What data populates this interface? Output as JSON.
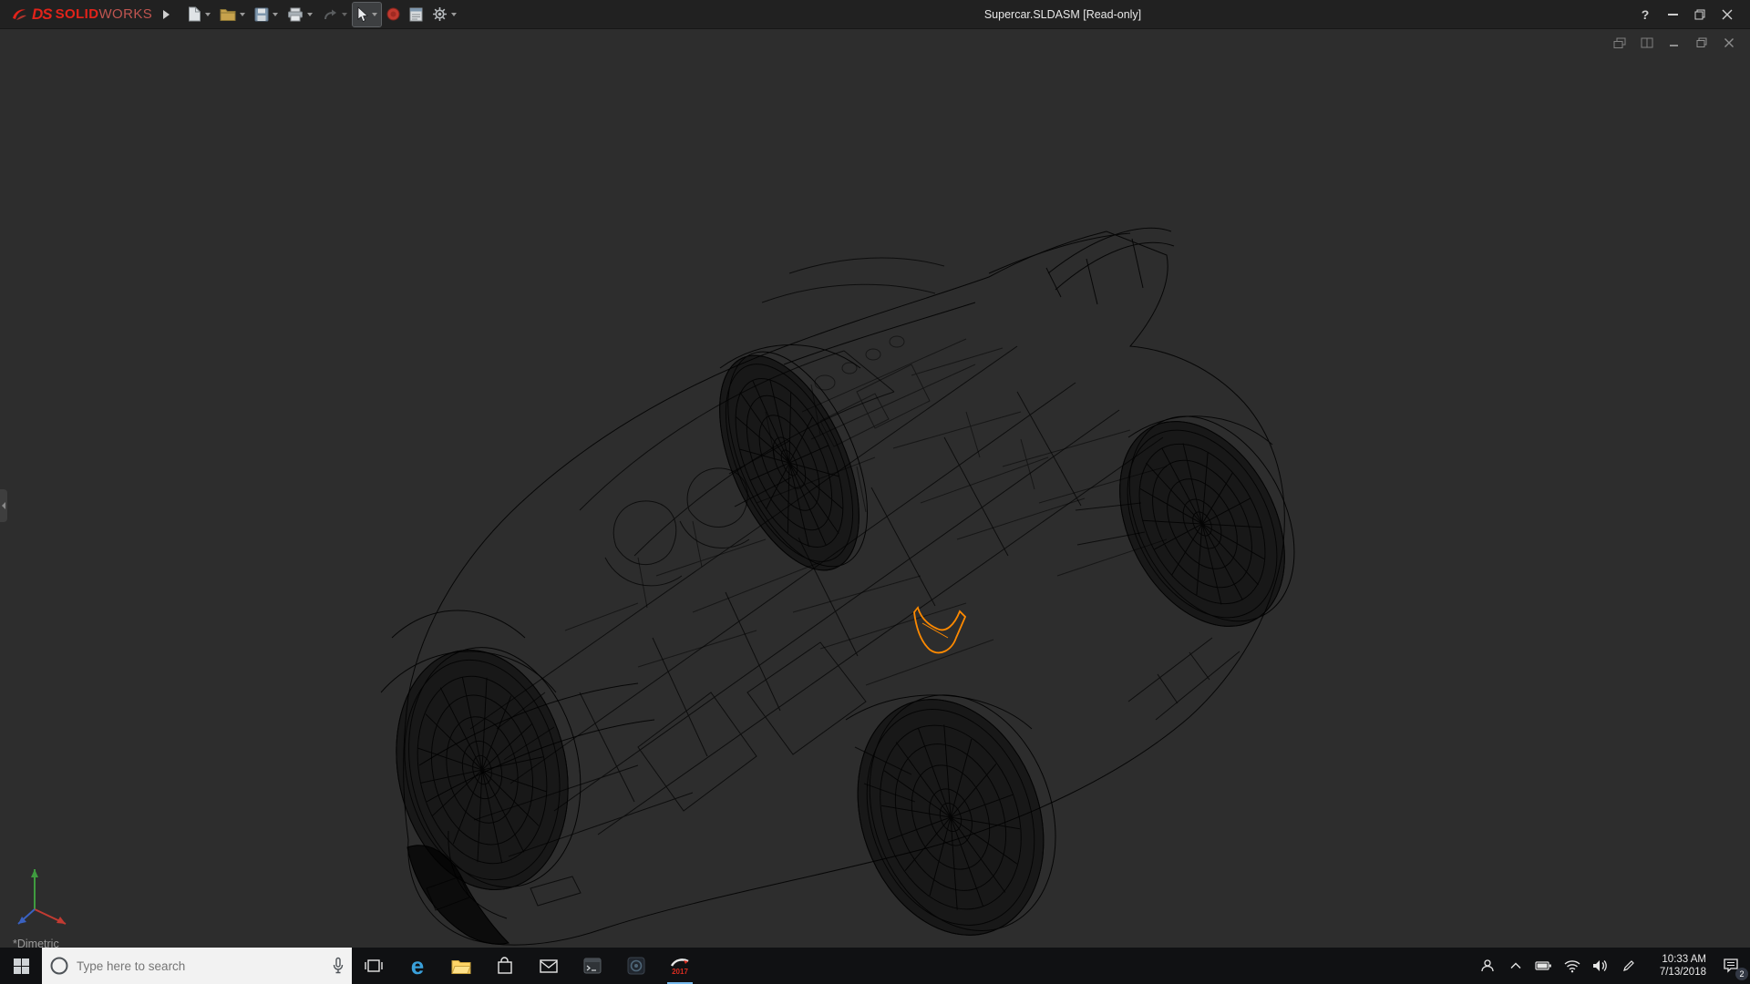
{
  "titlebar": {
    "brand": {
      "ds": "DS",
      "solid": "SOLID",
      "works": "WORKS"
    },
    "title": "Supercar.SLDASM [Read-only]",
    "help_glyph": "?"
  },
  "viewport": {
    "view_label": "*Dimetric"
  },
  "taskbar": {
    "search_placeholder": "Type here to search",
    "edge_glyph": "e",
    "solidworks_year": "2017",
    "clock": {
      "time": "10:33 AM",
      "date": "7/13/2018"
    },
    "notification_badge": "2"
  }
}
